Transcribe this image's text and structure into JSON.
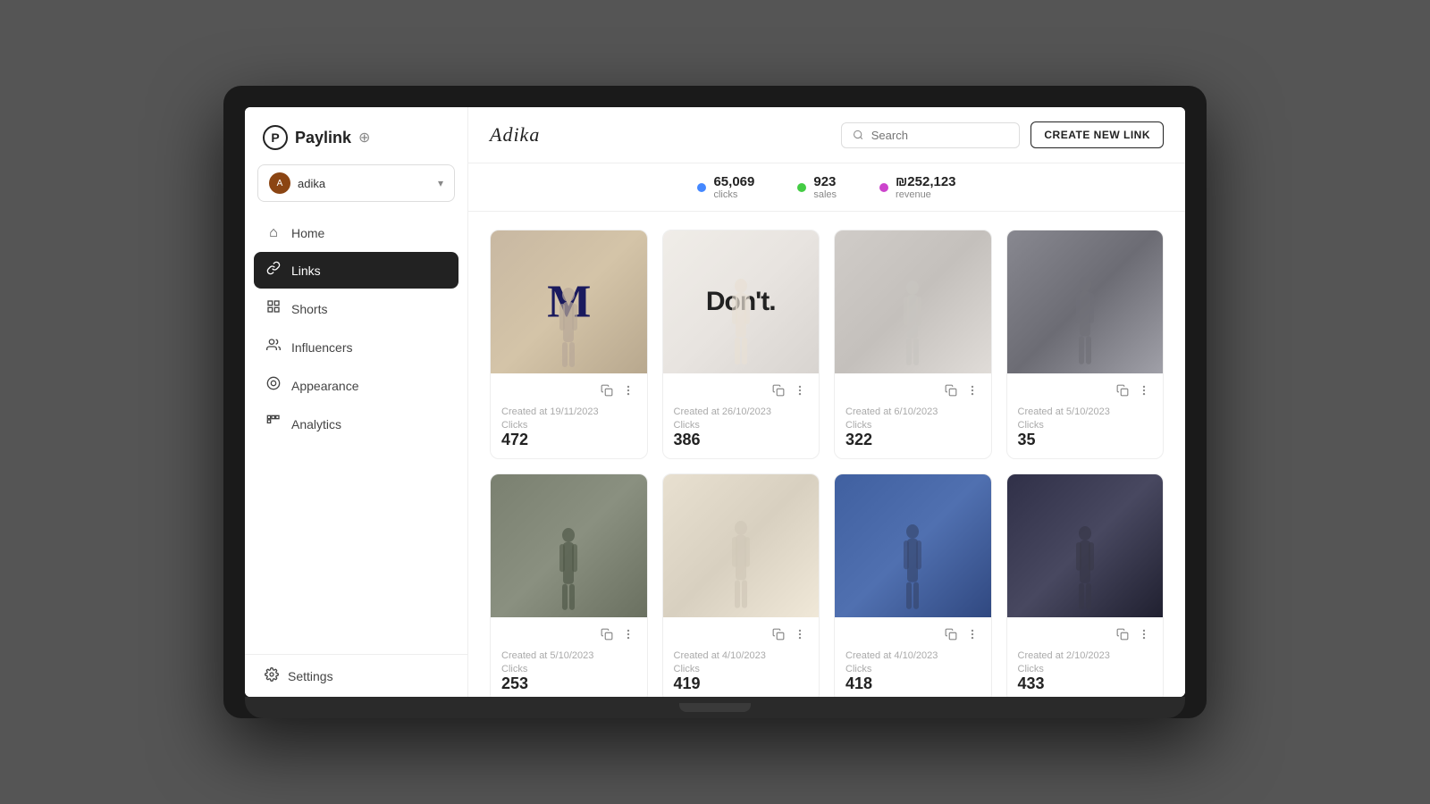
{
  "app": {
    "name": "Paylink",
    "logo_symbol": "⊕"
  },
  "user": {
    "name": "adika",
    "avatar_initials": "A"
  },
  "sidebar": {
    "nav_items": [
      {
        "id": "home",
        "label": "Home",
        "icon": "⌂",
        "active": false
      },
      {
        "id": "links",
        "label": "Links",
        "icon": "🔗",
        "active": true
      },
      {
        "id": "shorts",
        "label": "Shorts",
        "icon": "▦",
        "active": false
      },
      {
        "id": "influencers",
        "label": "Influencers",
        "icon": "👤",
        "active": false
      },
      {
        "id": "appearance",
        "label": "Appearance",
        "icon": "◎",
        "active": false
      },
      {
        "id": "analytics",
        "label": "Analytics",
        "icon": "▦",
        "active": false
      }
    ],
    "settings_label": "Settings"
  },
  "header": {
    "brand": "Adika",
    "search_placeholder": "Search",
    "create_button": "CREATE NEW LINK"
  },
  "stats": [
    {
      "value": "65,069",
      "label": "clicks",
      "color": "#4488ff"
    },
    {
      "value": "923",
      "label": "sales",
      "color": "#44cc44"
    },
    {
      "value": "₪252,123",
      "label": "revenue",
      "color": "#cc44cc"
    }
  ],
  "cards": [
    {
      "id": 1,
      "date": "Created at 19/11/2023",
      "clicks_label": "Clicks",
      "clicks": "472",
      "img_class": "card-img-1",
      "overlay": "M",
      "overlay_style": ""
    },
    {
      "id": 2,
      "date": "Created at 26/10/2023",
      "clicks_label": "Clicks",
      "clicks": "386",
      "img_class": "card-img-2",
      "overlay": "Don't.",
      "overlay_style": ""
    },
    {
      "id": 3,
      "date": "Created at 6/10/2023",
      "clicks_label": "Clicks",
      "clicks": "322",
      "img_class": "card-img-3",
      "overlay": "",
      "overlay_style": ""
    },
    {
      "id": 4,
      "date": "Created at 5/10/2023",
      "clicks_label": "Clicks",
      "clicks": "35",
      "img_class": "card-img-4",
      "overlay": "",
      "overlay_style": ""
    },
    {
      "id": 5,
      "date": "Created at 5/10/2023",
      "clicks_label": "Clicks",
      "clicks": "253",
      "img_class": "card-img-5",
      "overlay": "",
      "overlay_style": ""
    },
    {
      "id": 6,
      "date": "Created at 4/10/2023",
      "clicks_label": "Clicks",
      "clicks": "419",
      "img_class": "card-img-6",
      "overlay": "",
      "overlay_style": ""
    },
    {
      "id": 7,
      "date": "Created at 4/10/2023",
      "clicks_label": "Clicks",
      "clicks": "418",
      "img_class": "card-img-7",
      "overlay": "",
      "overlay_style": ""
    },
    {
      "id": 8,
      "date": "Created at 2/10/2023",
      "clicks_label": "Clicks",
      "clicks": "433",
      "img_class": "card-img-8",
      "overlay": "",
      "overlay_style": ""
    }
  ]
}
